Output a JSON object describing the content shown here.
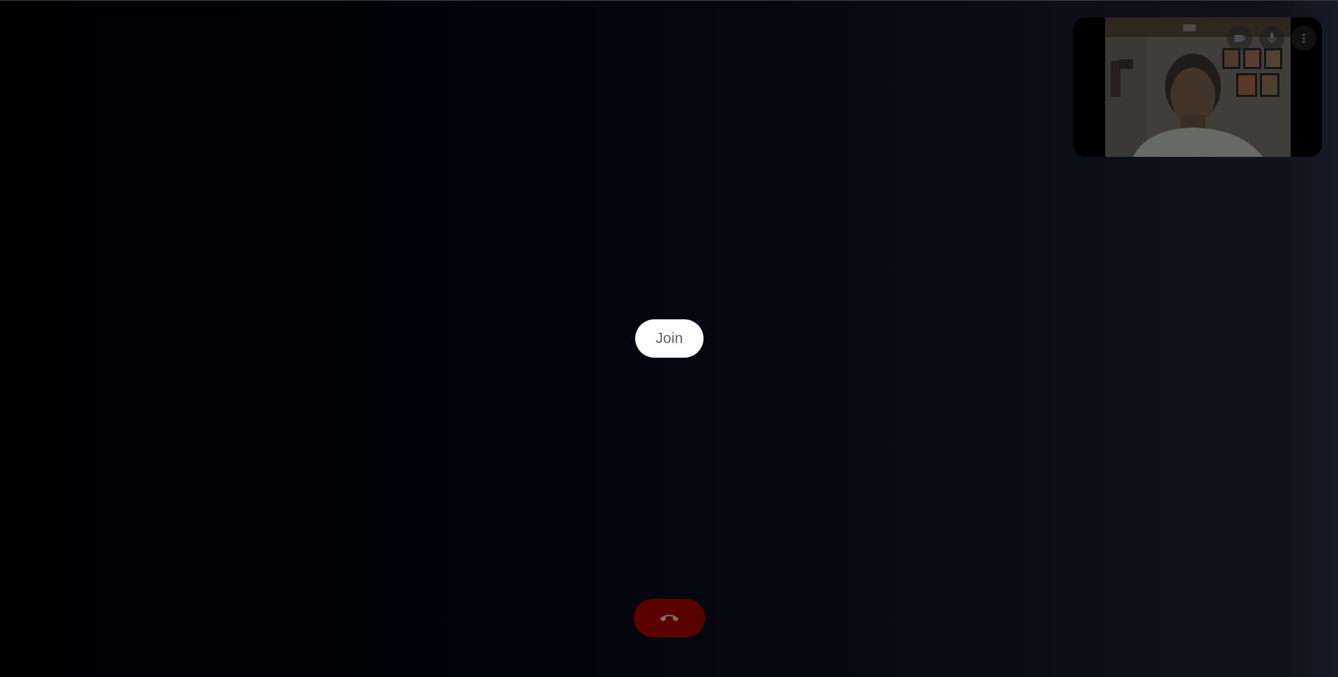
{
  "meeting": {
    "join_label": "Join"
  },
  "self_view": {
    "camera_icon": "videocam-icon",
    "mic_icon": "mic-icon",
    "more_icon": "more-vert-icon"
  },
  "controls": {
    "hangup_icon": "call-end-icon",
    "hangup_color": "#5a0000"
  },
  "colors": {
    "join_bg": "#ffffff",
    "join_text": "#5f6368",
    "background": "#000000"
  }
}
